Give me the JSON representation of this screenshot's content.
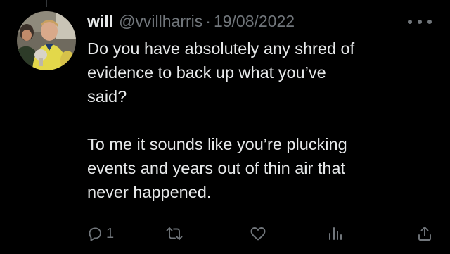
{
  "tweet": {
    "author_name": "will",
    "author_handle": "@vvillharris",
    "separator": "·",
    "date": "19/08/2022",
    "paragraphs": [
      "Do you have absolutely any shred of\nevidence to back up what you’ve\nsaid?",
      "To me it sounds like you’re plucking\nevents and years out of thin air that\nnever happened."
    ]
  },
  "actions": {
    "reply_count": "1",
    "icons": [
      "reply-icon",
      "retweet-icon",
      "like-icon",
      "views-icon",
      "share-icon"
    ]
  },
  "colors": {
    "background": "#000000",
    "primary_text": "#e7e9ea",
    "secondary_text": "#71767b",
    "thread_line": "#333639"
  }
}
